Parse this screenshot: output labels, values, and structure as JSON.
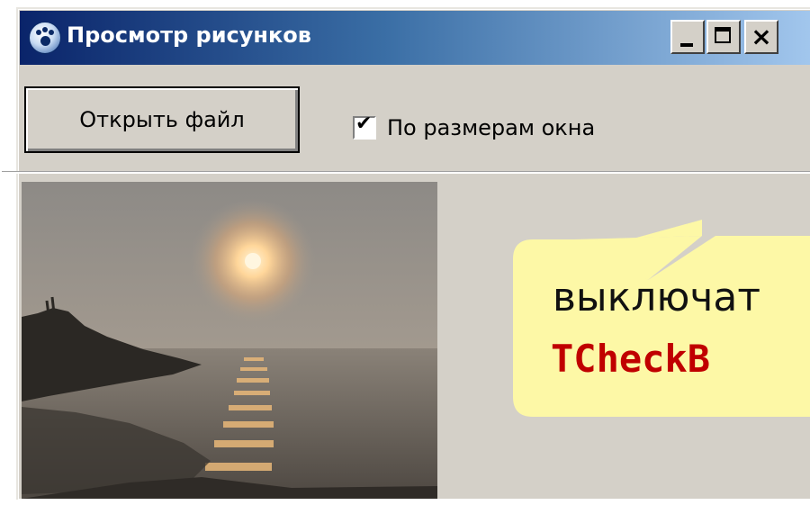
{
  "window": {
    "title": "Просмотр рисунков",
    "icon": "app-paw-icon",
    "controls": {
      "minimize": "minimize-icon",
      "maximize": "maximize-icon",
      "close_glyph": "×"
    }
  },
  "toolbar": {
    "open_label": "Открыть файл",
    "fit_checkbox": {
      "label": "По размерам окна",
      "checked": true,
      "mark": "✔"
    }
  },
  "image_area": {
    "content": "sunset-over-lake-photo"
  },
  "callout": {
    "line1": "выключат",
    "line2": "TCheckB",
    "background": "#fdf8a6",
    "code_color": "#c00000"
  },
  "colors": {
    "window_face": "#d4d0c8",
    "title_start": "#0a246a",
    "title_end": "#a6caf0"
  }
}
